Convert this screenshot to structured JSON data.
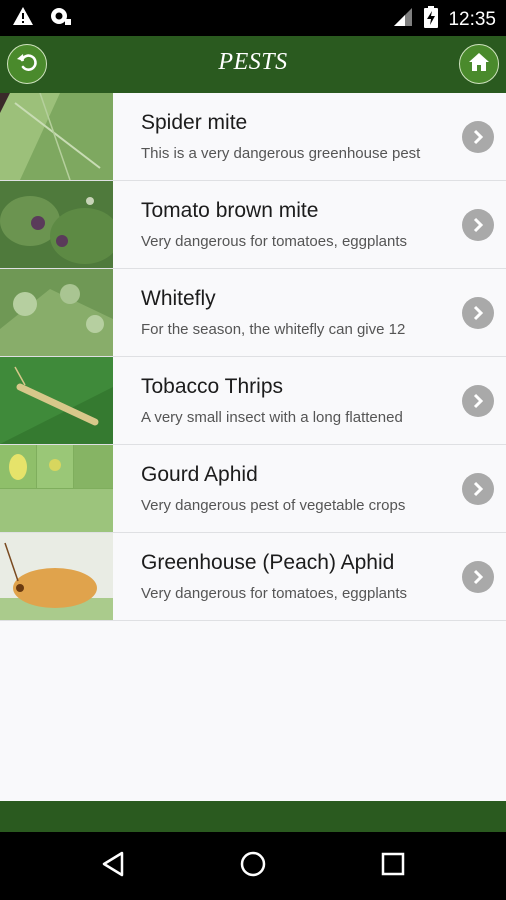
{
  "status_bar": {
    "time": "12:35",
    "icons": [
      "warning-icon",
      "camera-notification-icon",
      "signal-icon",
      "battery-charging-icon"
    ]
  },
  "app_bar": {
    "title": "PESTS",
    "back_icon": "back-arrow-icon",
    "home_icon": "home-icon",
    "color": "#2a5a1f"
  },
  "pests": [
    {
      "title": "Spider mite",
      "description": "This is a very dangerous greenhouse pest"
    },
    {
      "title": "Tomato brown mite",
      "description": "Very dangerous for tomatoes, eggplants"
    },
    {
      "title": "Whitefly",
      "description": "For the season, the whitefly can give 12"
    },
    {
      "title": "Tobacco Thrips",
      "description": "A very small insect with a long flattened"
    },
    {
      "title": "Gourd Aphid",
      "description": "Very dangerous pest of vegetable crops"
    },
    {
      "title": "Greenhouse (Peach) Aphid",
      "description": "Very dangerous for tomatoes, eggplants"
    }
  ],
  "nav_bar": {
    "icons": [
      "back-triangle-icon",
      "home-circle-icon",
      "recents-square-icon"
    ]
  }
}
